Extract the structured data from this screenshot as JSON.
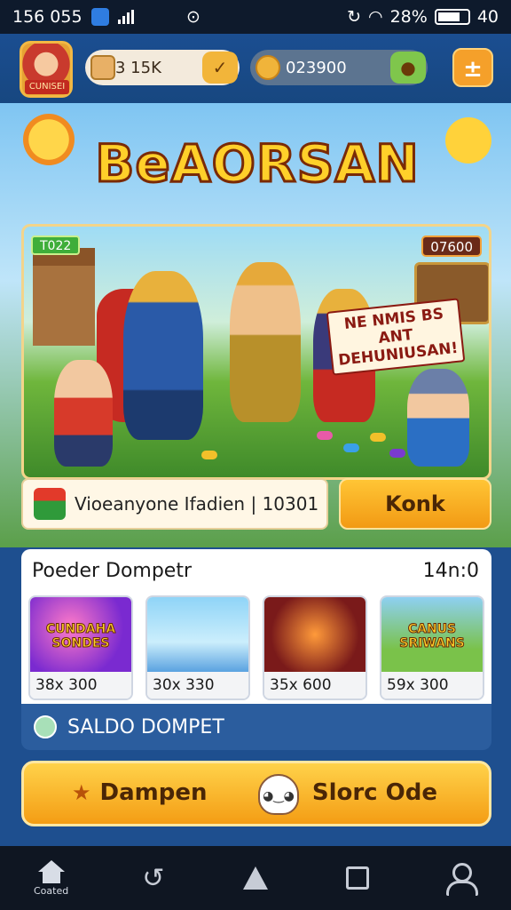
{
  "status_bar": {
    "time": "156 055",
    "battery": "28%",
    "extra": "40"
  },
  "top_bar": {
    "avatar_label": "CUNISEI",
    "balance_1": "3 15K",
    "balance_2": "023900"
  },
  "hero": {
    "title": "BeAORSAN",
    "tag_left": "T022",
    "tag_right": "07600",
    "promo_text": "NE NMIS BS ANT DEHUNIUSAN!"
  },
  "notice": {
    "text": "Vioeanyone Ifadien | 10301",
    "button_label": "Konk"
  },
  "games_panel": {
    "title": "Poeder Dompetr",
    "count": "14n:0",
    "cards": [
      {
        "title": "CUNDAHA SONDES",
        "multiplier": "38x 300"
      },
      {
        "title": "",
        "multiplier": "30x 330"
      },
      {
        "title": "",
        "multiplier": "35x 600"
      },
      {
        "title": "CANUS SRIWANS",
        "multiplier": "59x 300"
      }
    ]
  },
  "saldo": {
    "label": "SALDO DOMPET"
  },
  "action": {
    "left_label": "Dampen",
    "right_label": "Slorc Ode"
  },
  "nav": {
    "home_label": "Coated"
  }
}
